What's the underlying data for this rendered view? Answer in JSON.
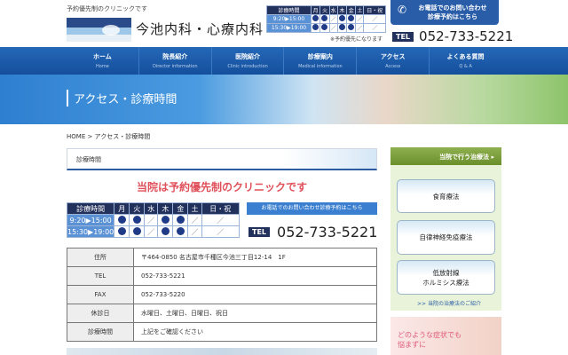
{
  "header": {
    "tagline": "予約優先制のクリニックです",
    "clinic_name": "今池内科・心療内科",
    "note": "※予約優先になります",
    "contact_line1": "お電話でのお問い合わせ",
    "contact_line2": "診療予約はこちら",
    "tel_label": "TEL",
    "tel": "052-733-5221"
  },
  "schedule": {
    "header": [
      "診療時間",
      "月",
      "火",
      "水",
      "木",
      "金",
      "土",
      "日・祝"
    ],
    "rows": [
      {
        "time": "9:20▶15:00",
        "marks": [
          "dot",
          "dot",
          "slash",
          "dot",
          "dot",
          "slash",
          "slash"
        ]
      },
      {
        "time": "15:30▶19:00",
        "marks": [
          "dot",
          "dot",
          "slash",
          "dot",
          "dot",
          "slash",
          "slash"
        ]
      }
    ]
  },
  "nav": [
    {
      "jp": "ホーム",
      "en": "Home"
    },
    {
      "jp": "院長紹介",
      "en": "Director information"
    },
    {
      "jp": "医院紹介",
      "en": "Clinic introduction"
    },
    {
      "jp": "診療案内",
      "en": "Medical information"
    },
    {
      "jp": "アクセス",
      "en": "Access"
    },
    {
      "jp": "よくある質問",
      "en": "Q & A"
    }
  ],
  "banner_title": "アクセス・診療時間",
  "breadcrumb": "HOME > アクセス・診療時間",
  "section_title": "診療時間",
  "headline": "当院は予約優先制のクリニックです",
  "contact_button": "お電話でのお問い合わせ診療予約はこちら",
  "info": [
    {
      "k": "住所",
      "v": "〒464-0850 名古屋市千種区今池三丁目12-14　1F"
    },
    {
      "k": "TEL",
      "v": "052-733-5221"
    },
    {
      "k": "FAX",
      "v": "052-733-5220"
    },
    {
      "k": "休診日",
      "v": "水曜日、土曜日、日曜日、祝日"
    },
    {
      "k": "診療時間",
      "v": "上記をご確認ください"
    }
  ],
  "sidebar": {
    "title": "当院で行う治療法",
    "buttons": [
      "食育療法",
      "自律神経免疫療法",
      "低放射線\nホルミシス療法"
    ],
    "link": ">> 当院の治療法のご紹介",
    "ad_line1": "どのような症状でも",
    "ad_line2": "悩まずに"
  },
  "colors": {
    "navy": "#22305c",
    "nav": "#1a5aa8",
    "red": "#e0505a",
    "green": "#7a9c3a"
  }
}
